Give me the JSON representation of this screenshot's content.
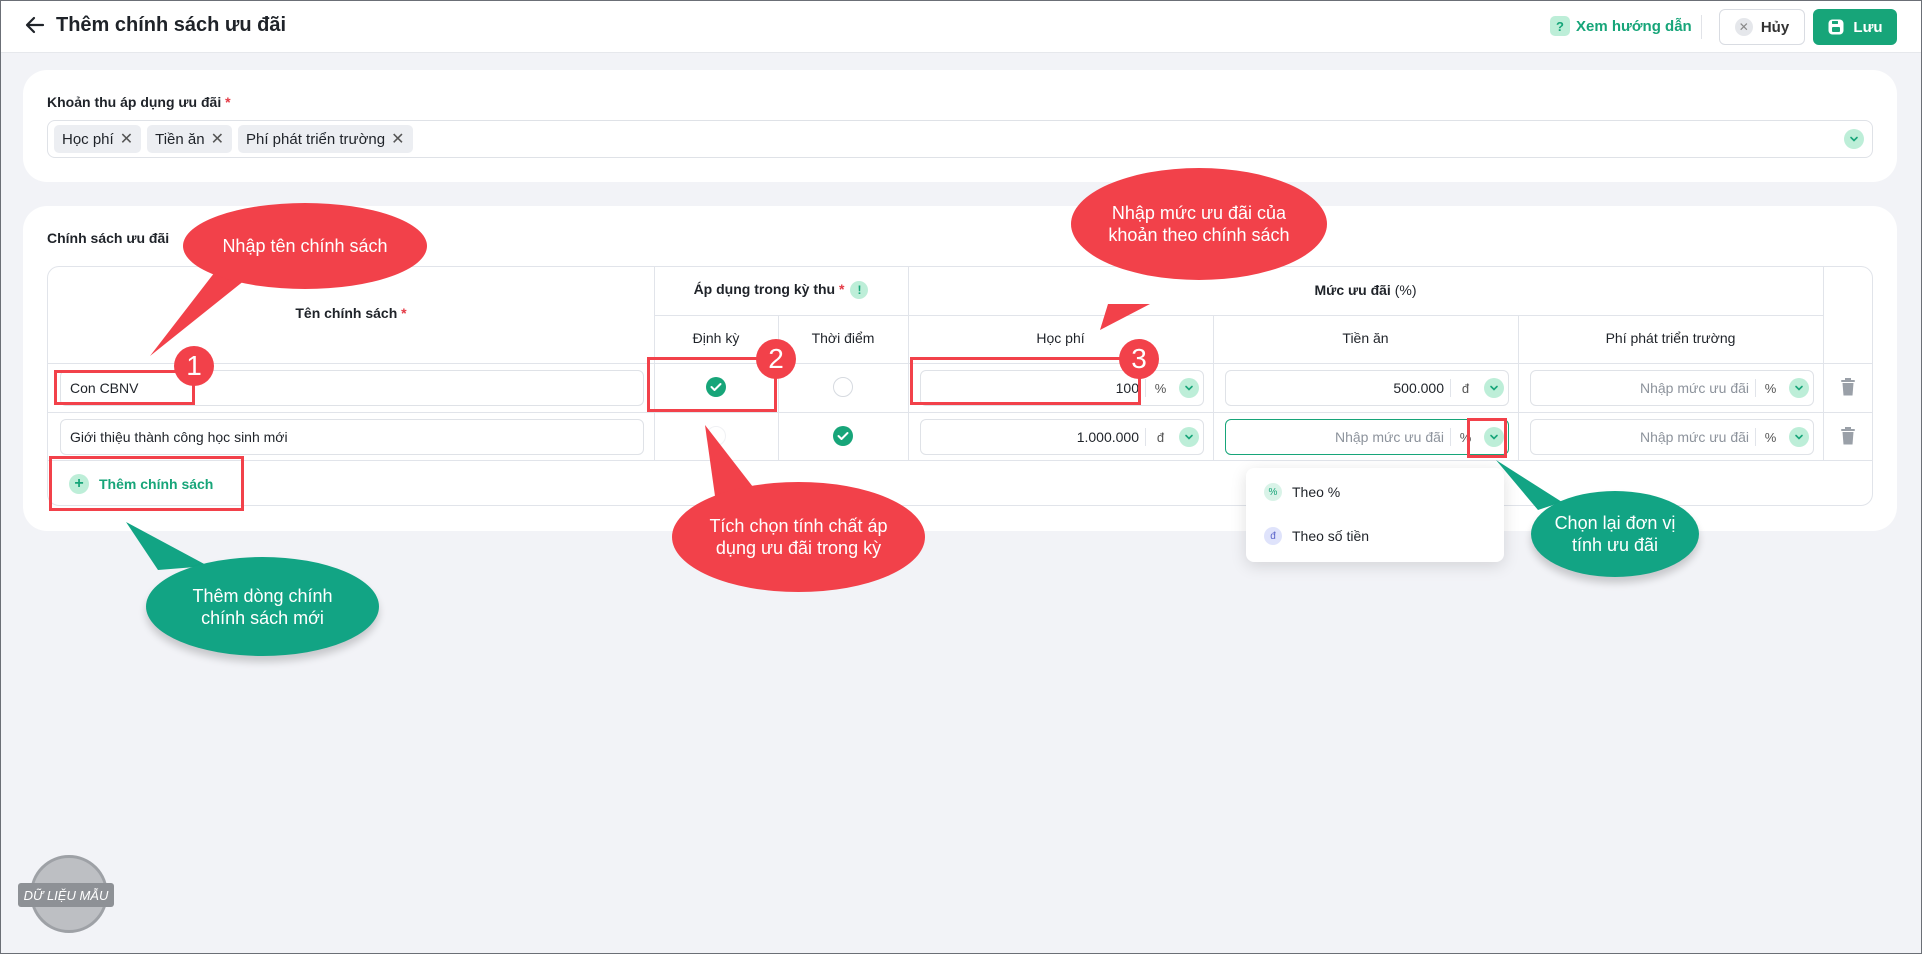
{
  "header": {
    "title": "Thêm chính sách ưu đãi",
    "guide_label": "Xem hướng dẫn",
    "cancel_label": "Hủy",
    "save_label": "Lưu"
  },
  "fees_section": {
    "label": "Khoản thu áp dụng ưu đãi",
    "required_mark": "*",
    "tags": [
      "Học phí",
      "Tiền ăn",
      "Phí phát triển trường"
    ]
  },
  "policy_section": {
    "label": "Chính sách ưu đãi",
    "headers": {
      "name": "Tên chính sách",
      "apply_period": "Áp dụng trong kỳ thu",
      "periodic": "Định kỳ",
      "point_in_time": "Thời điểm",
      "discount_level": "Mức ưu đãi",
      "discount_unit": "(%)",
      "tuition": "Học phí",
      "meals": "Tiền ăn",
      "dev_fee": "Phí phát triển trường",
      "required_mark": "*"
    },
    "rows": [
      {
        "name": "Con CBNV",
        "periodic": true,
        "point_in_time": false,
        "tuition": {
          "value": "100",
          "unit": "%"
        },
        "meals": {
          "value": "500.000",
          "unit": "đ"
        },
        "dev_fee": {
          "placeholder": "Nhập mức ưu đãi",
          "unit": "%"
        }
      },
      {
        "name": "Giới thiệu thành công học sinh mới",
        "periodic": false,
        "point_in_time": true,
        "tuition": {
          "value": "1.000.000",
          "unit": "đ"
        },
        "meals": {
          "placeholder": "Nhập mức ưu đãi",
          "unit": "%"
        },
        "dev_fee": {
          "placeholder": "Nhập mức ưu đãi",
          "unit": "%"
        }
      }
    ],
    "add_label": "Thêm chính sách"
  },
  "unit_dropdown": {
    "options": [
      {
        "label": "Theo %",
        "icon": "percent-icon"
      },
      {
        "label": "Theo số tiền",
        "icon": "dong-icon"
      }
    ]
  },
  "annotations": {
    "bubble_name": "Nhập tên chính sách",
    "bubble_level_line1": "Nhập mức ưu đãi của",
    "bubble_level_line2": "khoản theo chính sách",
    "bubble_check_line1": "Tích chọn tính chất áp",
    "bubble_check_line2": "dụng ưu đãi trong kỳ",
    "bubble_add_line1": "Thêm dòng chính",
    "bubble_add_line2": "chính sách mới",
    "bubble_unit_line1": "Chọn lại đơn vị",
    "bubble_unit_line2": "tính ưu đãi",
    "badges": [
      "1",
      "2",
      "3"
    ]
  },
  "stamp_label": "DỮ LIỆU MẪU",
  "colors": {
    "accent": "#17a579",
    "annotation_red": "#f2414a",
    "annotation_green": "#12a484"
  }
}
